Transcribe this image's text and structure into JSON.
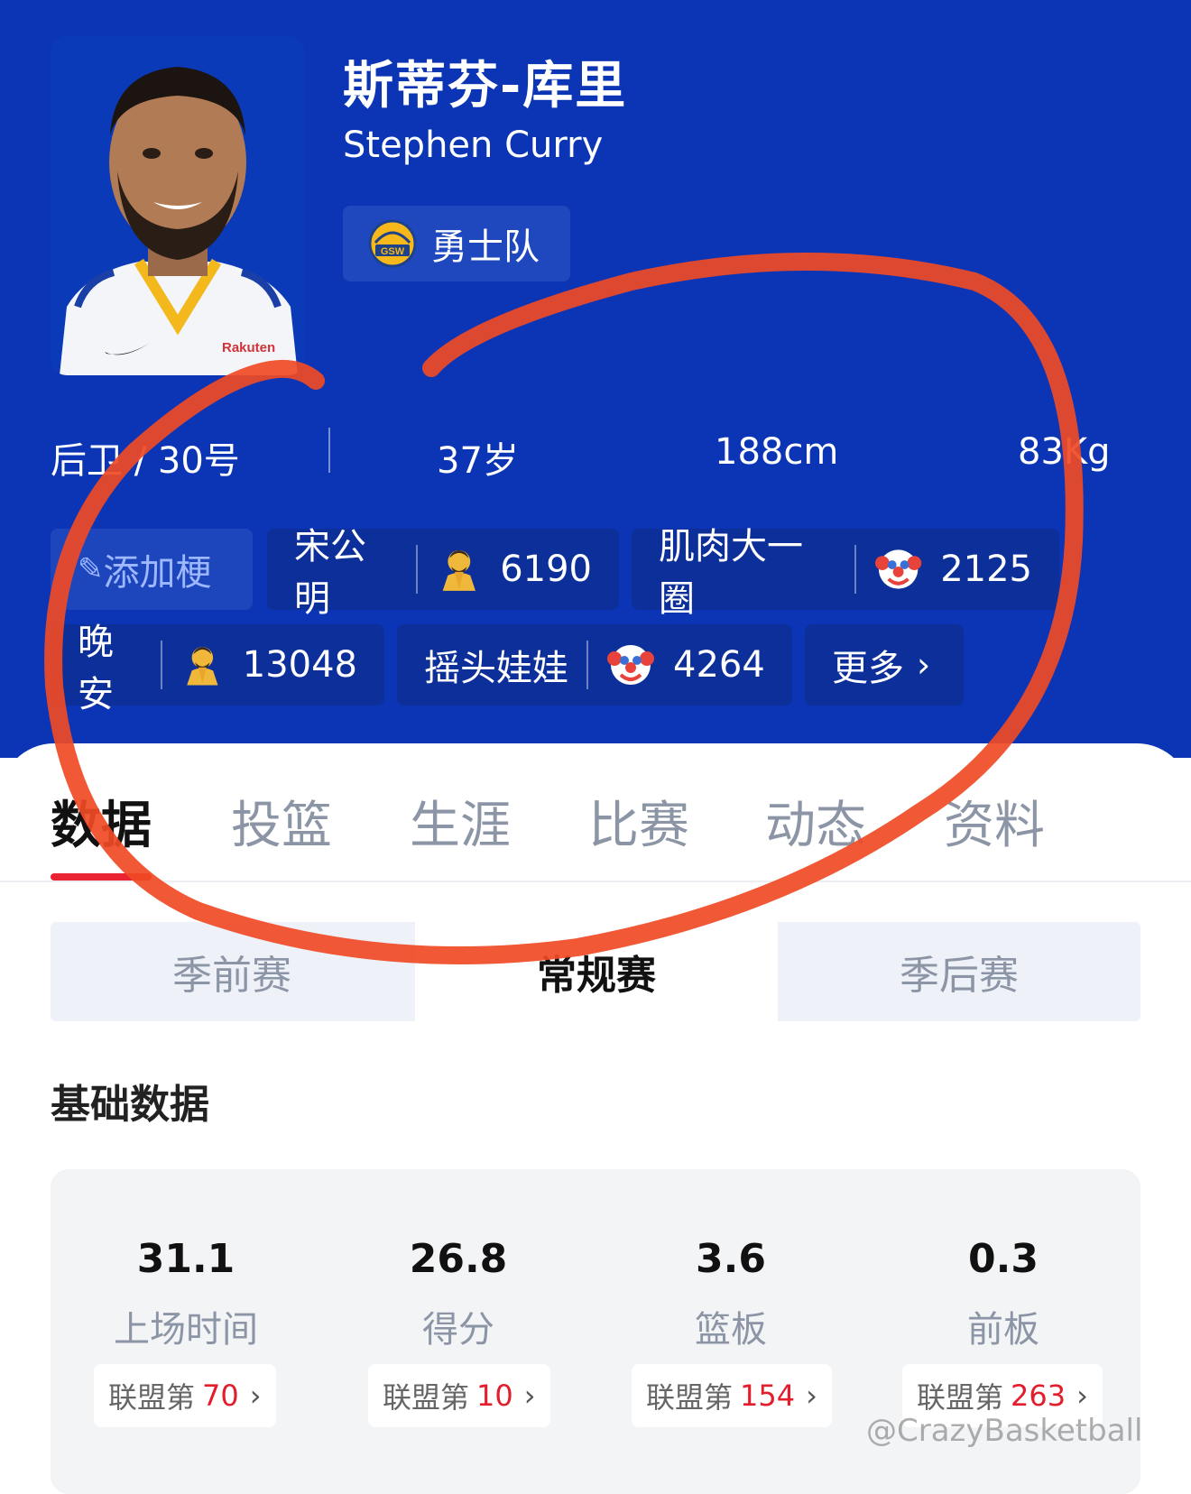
{
  "player": {
    "name_cn": "斯蒂芬-库里",
    "name_en": "Stephen Curry",
    "team": "勇士队",
    "team_logo_text": "GSW",
    "jersey_text": "Rakuten"
  },
  "info": {
    "position": "后卫 / 30号",
    "age": "37岁",
    "height": "188cm",
    "weight": "83Kg"
  },
  "tags": {
    "add_label": "添加梗",
    "more_label": "更多",
    "items": [
      {
        "label": "宋公明",
        "emoji": "praying-person-icon",
        "count": "6190"
      },
      {
        "label": "肌肉大一圈",
        "emoji": "clown-icon",
        "count": "2125"
      },
      {
        "label": "晚安",
        "emoji": "praying-person-icon",
        "count": "13048"
      },
      {
        "label": "摇头娃娃",
        "emoji": "clown-icon",
        "count": "4264"
      }
    ]
  },
  "tabs": [
    "数据",
    "投篮",
    "生涯",
    "比赛",
    "动态",
    "资料"
  ],
  "season_tabs": [
    "季前赛",
    "常规赛",
    "季后赛"
  ],
  "section_title": "基础数据",
  "stats": [
    {
      "value": "31.1",
      "label": "上场时间",
      "rank_prefix": "联盟第",
      "rank": "70"
    },
    {
      "value": "26.8",
      "label": "得分",
      "rank_prefix": "联盟第",
      "rank": "10"
    },
    {
      "value": "3.6",
      "label": "篮板",
      "rank_prefix": "联盟第",
      "rank": "154"
    },
    {
      "value": "0.3",
      "label": "前板",
      "rank_prefix": "联盟第",
      "rank": "263"
    }
  ],
  "watermark": "@CrazyBasketball",
  "colors": {
    "hero_bg": "#0b35b5",
    "accent_red": "#e31d2b",
    "annotation": "#f04a25"
  }
}
